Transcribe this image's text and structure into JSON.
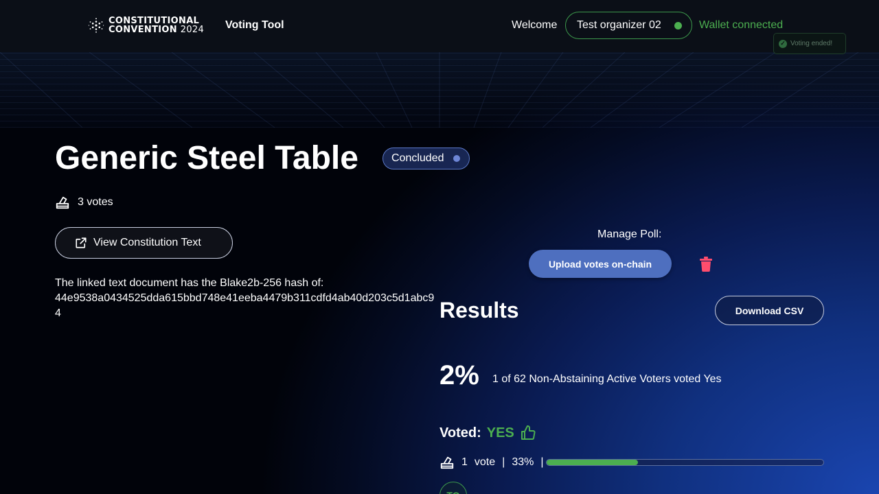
{
  "header": {
    "logo_line1": "CONSTITUTIONAL",
    "logo_line2_bold": "CONVENTION",
    "logo_line2_year": "2024",
    "nav_title": "Voting Tool",
    "welcome": "Welcome",
    "user_name": "Test organizer 02",
    "wallet_status": "Wallet connected",
    "toast": "Voting ended!"
  },
  "poll": {
    "title": "Generic Steel Table",
    "status": "Concluded",
    "votes_count": "3 votes",
    "constitution_button": "View Constitution Text",
    "hash_intro": "The linked text document has the Blake2b-256 hash of:",
    "hash_value": "44e9538a0434525dda615bbd748e41eeba4479b311cdfd4ab40d203c5d1abc94"
  },
  "manage": {
    "label": "Manage Poll:",
    "upload_button": "Upload votes on-chain"
  },
  "results": {
    "title": "Results",
    "download_button": "Download CSV",
    "percent": "2%",
    "summary": "1 of 62 Non-Abstaining Active Voters voted Yes",
    "voted_label": "Voted:",
    "voted_value": "YES",
    "vote_count": "1",
    "vote_word": "vote",
    "vote_percent": "33%",
    "separator": "|",
    "progress_fraction": 0.33,
    "avatar_initials": "TO"
  },
  "colors": {
    "accent_green": "#4caf50",
    "primary_blue": "#4e6fbf",
    "danger_red": "#ff4d6d"
  },
  "icons": [
    "constitution-logo-icon",
    "ballot-icon",
    "external-link-icon",
    "trash-icon",
    "thumbs-up-icon",
    "check-icon"
  ]
}
